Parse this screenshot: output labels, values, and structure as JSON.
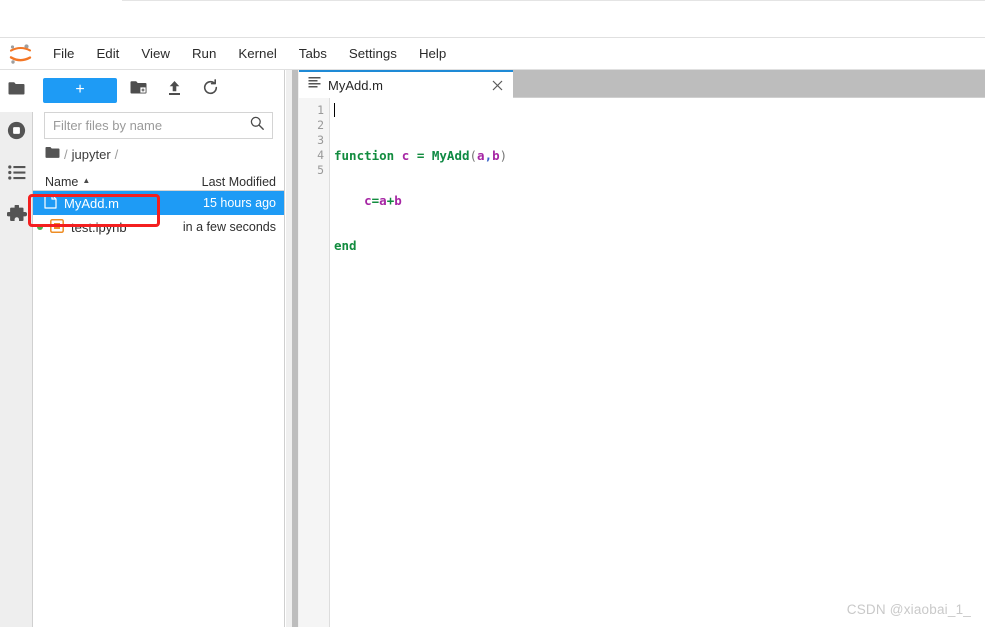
{
  "app": {
    "name": "JupyterLab",
    "logo_icon": "jupyter-logo"
  },
  "menubar": {
    "items": [
      {
        "label": "File"
      },
      {
        "label": "Edit"
      },
      {
        "label": "View"
      },
      {
        "label": "Run"
      },
      {
        "label": "Kernel"
      },
      {
        "label": "Tabs"
      },
      {
        "label": "Settings"
      },
      {
        "label": "Help"
      }
    ]
  },
  "activitybar": {
    "items": [
      {
        "icon": "folder-icon",
        "label": "File Browser",
        "selected": true
      },
      {
        "icon": "running-sessions-icon",
        "label": "Running Terminals and Kernels",
        "selected": false
      },
      {
        "icon": "commands-list-icon",
        "label": "Commands",
        "selected": false
      },
      {
        "icon": "extension-puzzle-icon",
        "label": "Extension Manager",
        "selected": false
      }
    ]
  },
  "filebrowser": {
    "toolbar": {
      "new_launcher_label": "+",
      "new_folder_icon": "new-folder-icon",
      "upload_icon": "upload-icon",
      "refresh_icon": "refresh-icon"
    },
    "filter": {
      "placeholder": "Filter files by name",
      "value": "",
      "icon": "search-icon"
    },
    "breadcrumb": {
      "home_icon": "folder-icon",
      "lead_separator": "/",
      "path_segment": "jupyter",
      "trail_separator": "/"
    },
    "columns": {
      "name": "Name",
      "last_modified": "Last Modified",
      "sort_caret": "▲"
    },
    "rows": [
      {
        "name": "MyAdd.m",
        "last_modified": "15 hours ago",
        "icon": "file-text-icon",
        "selected": true,
        "running": false
      },
      {
        "name": "test.ipynb",
        "last_modified": "in a few seconds",
        "icon": "notebook-icon",
        "selected": false,
        "running": true
      }
    ]
  },
  "dock": {
    "tabs": [
      {
        "title": "MyAdd.m",
        "icon": "text-editor-icon",
        "close_icon": "close-icon",
        "active": true
      }
    ]
  },
  "editor": {
    "line_numbers": [
      "1",
      "2",
      "3",
      "4",
      "5"
    ],
    "lines": [
      "function c = MyAdd(a,b)",
      "    c=a+b",
      "end",
      "",
      ""
    ]
  },
  "annotation": {
    "type": "highlight-rectangle",
    "color": "#f41f1f",
    "targets": "MyAdd.m file row"
  },
  "watermark": {
    "text": "CSDN @xiaobai_1_"
  },
  "colors": {
    "accent": "#1e9bf5",
    "tab_active_border": "#1e8ad6",
    "annotation_red": "#f41f1f",
    "running_dot_green": "#4caf50",
    "notebook_orange": "#ee8d24",
    "keyword_green": "#128c3f",
    "identifier_purple": "#a626a4"
  }
}
